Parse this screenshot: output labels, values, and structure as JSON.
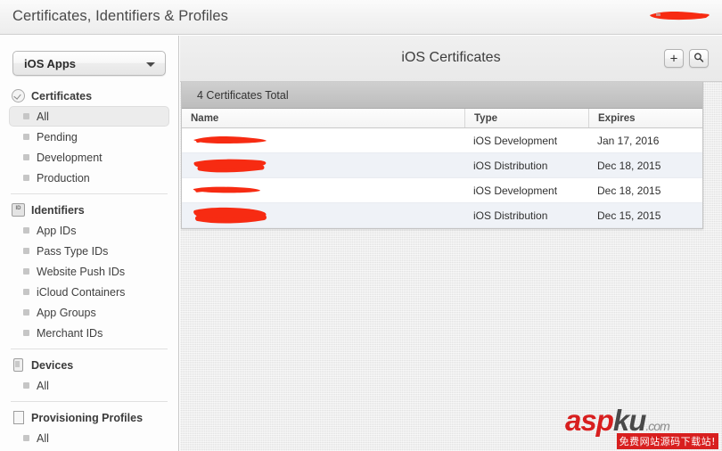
{
  "titlebar": {
    "title": "Certificates, Identifiers & Profiles",
    "account_redacted": true
  },
  "sidebar": {
    "dropdown": {
      "selected": "iOS Apps",
      "icon": "chevron-down-icon"
    },
    "groups": [
      {
        "label": "Certificates",
        "icon": "certificate-icon",
        "items": [
          {
            "label": "All",
            "selected": true
          },
          {
            "label": "Pending",
            "selected": false
          },
          {
            "label": "Development",
            "selected": false
          },
          {
            "label": "Production",
            "selected": false
          }
        ]
      },
      {
        "label": "Identifiers",
        "icon": "id-badge-icon",
        "items": [
          {
            "label": "App IDs",
            "selected": false
          },
          {
            "label": "Pass Type IDs",
            "selected": false
          },
          {
            "label": "Website Push IDs",
            "selected": false
          },
          {
            "label": "iCloud Containers",
            "selected": false
          },
          {
            "label": "App Groups",
            "selected": false
          },
          {
            "label": "Merchant IDs",
            "selected": false
          }
        ]
      },
      {
        "label": "Devices",
        "icon": "device-icon",
        "items": [
          {
            "label": "All",
            "selected": false
          }
        ]
      },
      {
        "label": "Provisioning Profiles",
        "icon": "document-icon",
        "items": [
          {
            "label": "All",
            "selected": false
          }
        ]
      }
    ]
  },
  "main": {
    "title": "iOS Certificates",
    "add_button": {
      "icon": "plus-icon",
      "glyph": "+"
    },
    "search_button": {
      "icon": "search-icon",
      "glyph": "⌕"
    },
    "count_text": "4 Certificates Total",
    "columns": [
      "Name",
      "Type",
      "Expires"
    ],
    "rows": [
      {
        "name": "",
        "name_redacted": true,
        "type": "iOS Development",
        "expires": "Jan 17, 2016"
      },
      {
        "name": "",
        "name_redacted": true,
        "type": "iOS Distribution",
        "expires": "Dec 18, 2015"
      },
      {
        "name": "",
        "name_redacted": true,
        "type": "iOS Development",
        "expires": "Dec 18, 2015"
      },
      {
        "name": "",
        "name_redacted": true,
        "type": "iOS Distribution",
        "expires": "Dec 15, 2015"
      }
    ]
  },
  "watermark": {
    "brand_red": "asp",
    "brand_dark": "ku",
    "brand_tld": ".com",
    "subtitle": "免费网站源码下载站!"
  },
  "colors": {
    "redaction": "#f72b12",
    "brand_red": "#d81f1f",
    "row_alt": "#eff2f7",
    "count_bar": "#c5c5c5"
  }
}
